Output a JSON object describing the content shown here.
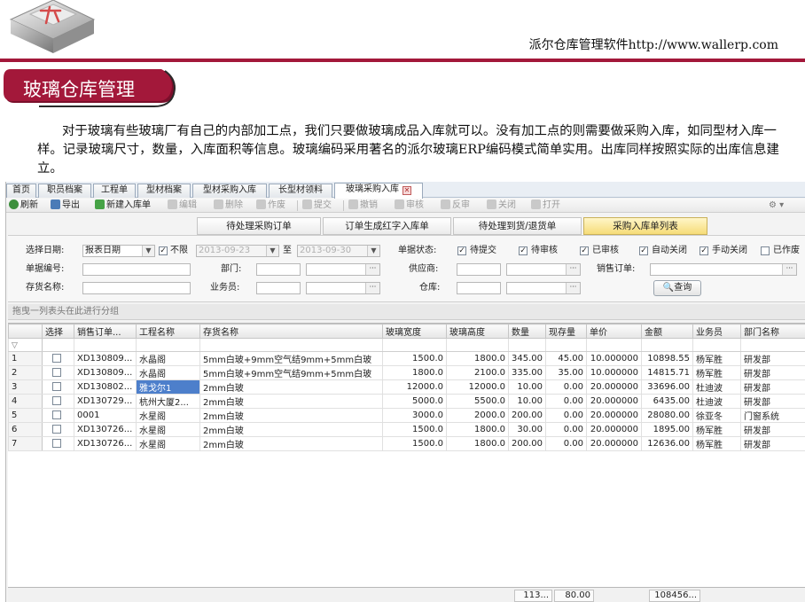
{
  "slide": {
    "brand_line": "派尔仓库管理软件http://www.wallerp.com",
    "title": "玻璃仓库管理",
    "intro": "对于玻璃有些玻璃厂有自己的内部加工点，我们只要做玻璃成品入库就可以。没有加工点的则需要做采购入库，如同型材入库一样。记录玻璃尺寸，数量，入库面积等信息。玻璃编码采用著名的派尔玻璃ERP编码模式简单实用。出库同样按照实际的出库信息建立。",
    "colors": {
      "accent": "#a3183a",
      "selection": "#4d7fcb",
      "active_subtab": "#f6dc78"
    }
  },
  "tabs": [
    {
      "label": "首页"
    },
    {
      "label": "职员档案"
    },
    {
      "label": "工程单"
    },
    {
      "label": "型材档案"
    },
    {
      "label": "型材采购入库"
    },
    {
      "label": "长型材领料"
    },
    {
      "label": "玻璃采购入库",
      "active": true
    }
  ],
  "toolbar": {
    "refresh": "刷新",
    "export": "导出",
    "new_receipt": "新建入库单",
    "edit": "编辑",
    "delete": "删除",
    "void": "作废",
    "submit": "提交",
    "withdraw": "撤销",
    "approve": "审核",
    "unapprove": "反审",
    "close": "关闭",
    "open": "打开"
  },
  "subtabs": [
    "待处理采购订单",
    "订单生成红字入库单",
    "待处理到货/退货单",
    "采购入库单列表"
  ],
  "filters": {
    "date_label": "选择日期:",
    "date_type": "报表日期",
    "unlimited_label": "不限",
    "date_from": "2013-09-23",
    "to_label": "至",
    "date_to": "2013-09-30",
    "status_label": "单据状态:",
    "statuses": [
      {
        "label": "待提交",
        "checked": true
      },
      {
        "label": "待审核",
        "checked": true
      },
      {
        "label": "已审核",
        "checked": true
      },
      {
        "label": "自动关闭",
        "checked": true
      },
      {
        "label": "手动关闭",
        "checked": true
      },
      {
        "label": "已作废",
        "checked": false
      }
    ],
    "doc_no_label": "单据编号:",
    "dept_label": "部门:",
    "supplier_label": "供应商:",
    "sales_order_label": "销售订单:",
    "item_name_label": "存货名称:",
    "clerk_label": "业务员:",
    "warehouse_label": "仓库:",
    "query_button": "查询"
  },
  "group_hint": "拖曳一列表头在此进行分组",
  "grid": {
    "columns": [
      "选择",
      "销售订单...",
      "工程名称",
      "存货名称",
      "玻璃宽度",
      "玻璃高度",
      "数量",
      "现存量",
      "单价",
      "金额",
      "业务员",
      "部门名称"
    ],
    "rows": [
      {
        "no": "1",
        "order": "XD130809...",
        "project": "水晶阁",
        "item": "5mm白玻+9mm空气结9mm+5mm白玻",
        "width": "1500.0",
        "height": "1800.0",
        "qty": "345.00",
        "stock": "45.00",
        "price": "10.000000",
        "amount": "10898.55",
        "clerk": "杨军胜",
        "dept": "研发部"
      },
      {
        "no": "2",
        "order": "XD130809...",
        "project": "水晶阁",
        "item": "5mm白玻+9mm空气结9mm+5mm白玻",
        "width": "1800.0",
        "height": "2100.0",
        "qty": "335.00",
        "stock": "35.00",
        "price": "10.000000",
        "amount": "14815.71",
        "clerk": "杨军胜",
        "dept": "研发部"
      },
      {
        "no": "3",
        "order": "XD130802...",
        "project": "雅戈尔1",
        "item": "2mm白玻",
        "width": "12000.0",
        "height": "12000.0",
        "qty": "10.00",
        "stock": "0.00",
        "price": "20.000000",
        "amount": "33696.00",
        "clerk": "杜迪波",
        "dept": "研发部",
        "current": true
      },
      {
        "no": "4",
        "order": "XD130729...",
        "project": "杭州大厦2...",
        "item": "2mm白玻",
        "width": "5000.0",
        "height": "5500.0",
        "qty": "10.00",
        "stock": "0.00",
        "price": "20.000000",
        "amount": "6435.00",
        "clerk": "杜迪波",
        "dept": "研发部"
      },
      {
        "no": "5",
        "order": "0001",
        "project": "水星阁",
        "item": "2mm白玻",
        "width": "3000.0",
        "height": "2000.0",
        "qty": "200.00",
        "stock": "0.00",
        "price": "20.000000",
        "amount": "28080.00",
        "clerk": "徐亚冬",
        "dept": "门窗系统"
      },
      {
        "no": "6",
        "order": "XD130726...",
        "project": "水星阁",
        "item": "2mm白玻",
        "width": "1500.0",
        "height": "1800.0",
        "qty": "30.00",
        "stock": "0.00",
        "price": "20.000000",
        "amount": "1895.00",
        "clerk": "杨军胜",
        "dept": "研发部"
      },
      {
        "no": "7",
        "order": "XD130726...",
        "project": "水星阁",
        "item": "2mm白玻",
        "width": "1500.0",
        "height": "1800.0",
        "qty": "200.00",
        "stock": "0.00",
        "price": "20.000000",
        "amount": "12636.00",
        "clerk": "杨军胜",
        "dept": "研发部"
      }
    ],
    "totals": {
      "qty": "113...",
      "stock": "80.00",
      "amount": "108456..."
    }
  }
}
